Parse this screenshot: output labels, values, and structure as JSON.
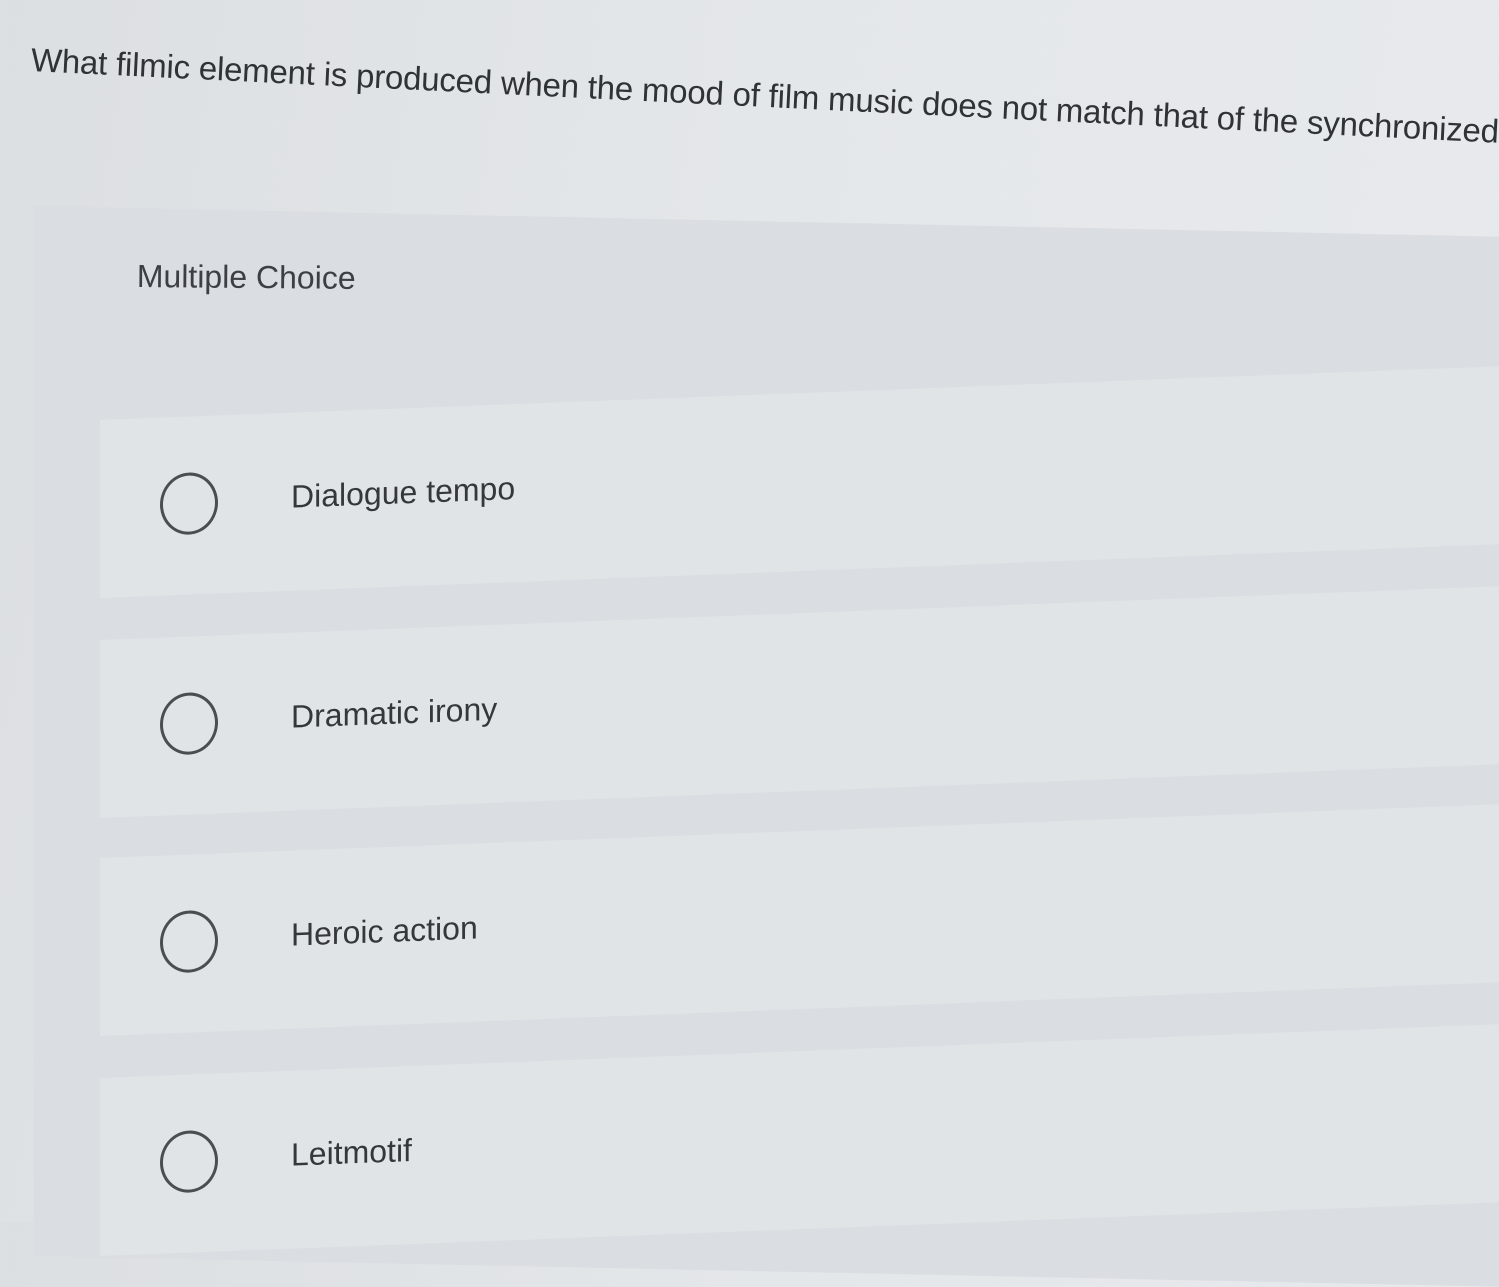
{
  "question": {
    "text": "What filmic element is produced when the mood of film music does not match that of the synchronized visual image?"
  },
  "section": {
    "label": "Multiple Choice"
  },
  "options": [
    {
      "label": "Dialogue tempo",
      "selected": false
    },
    {
      "label": "Dramatic irony",
      "selected": false
    },
    {
      "label": "Heroic action",
      "selected": false
    },
    {
      "label": "Leitmotif",
      "selected": false
    }
  ]
}
